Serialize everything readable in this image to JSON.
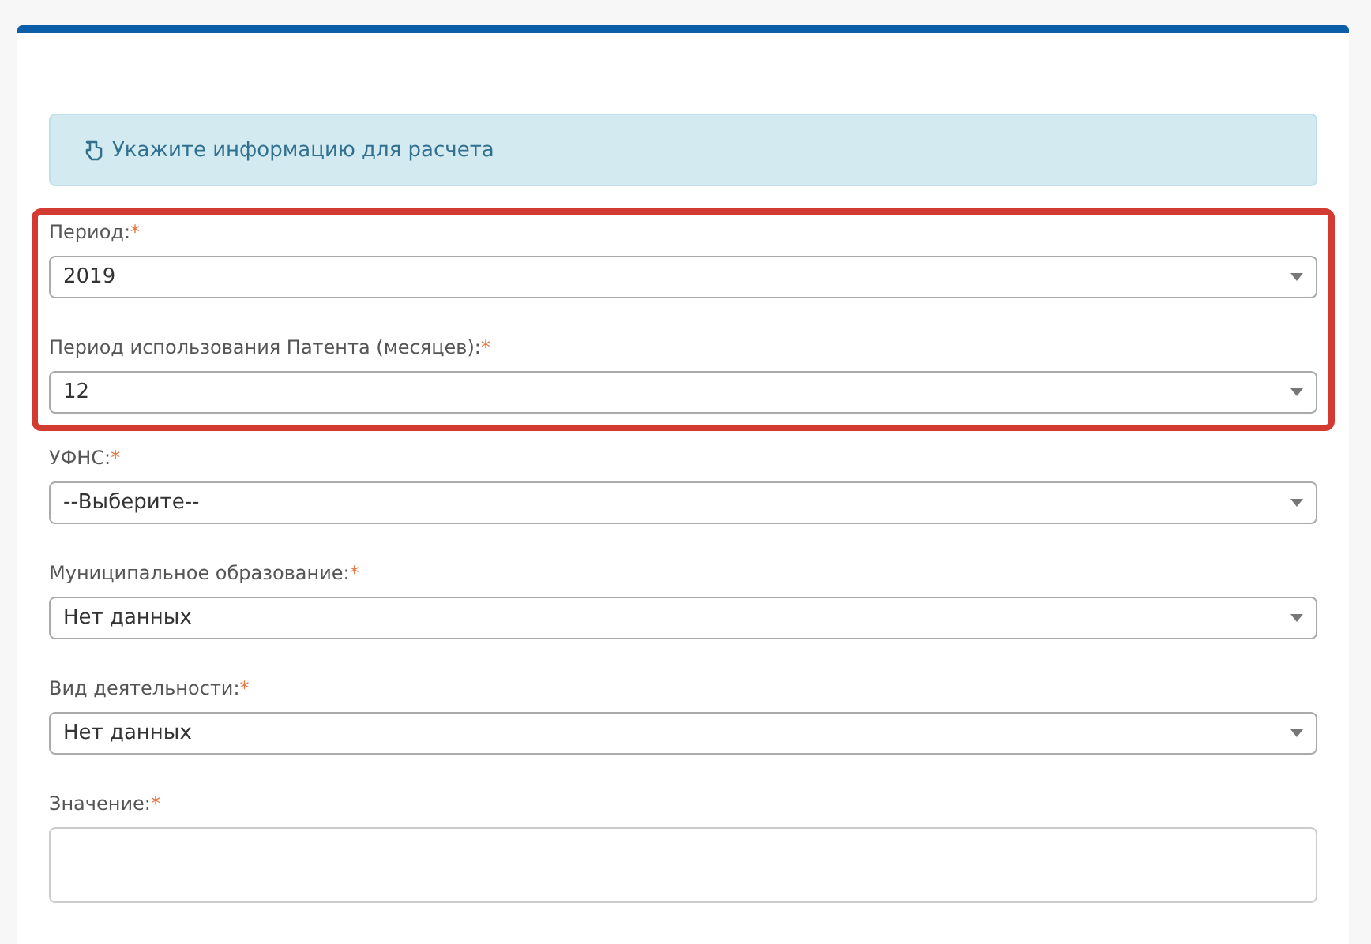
{
  "alert": {
    "text": "Укажите информацию для расчета"
  },
  "sections": [
    {
      "highlighted": true,
      "fields": [
        {
          "kind": "select",
          "label": "Период:",
          "required_mark": "*",
          "value": "2019"
        },
        {
          "kind": "select",
          "label": "Период использования Патента (месяцев):",
          "required_mark": "*",
          "value": "12"
        }
      ]
    },
    {
      "highlighted": false,
      "fields": [
        {
          "kind": "select",
          "label": "УФНС:",
          "required_mark": "*",
          "value": "--Выберите--"
        },
        {
          "kind": "select",
          "label": "Муниципальное образование:",
          "required_mark": "*",
          "value": "Нет данных"
        },
        {
          "kind": "select",
          "label": "Вид деятельности:",
          "required_mark": "*",
          "value": "Нет данных"
        },
        {
          "kind": "textarea",
          "label": "Значение:",
          "required_mark": "*"
        }
      ]
    }
  ]
}
